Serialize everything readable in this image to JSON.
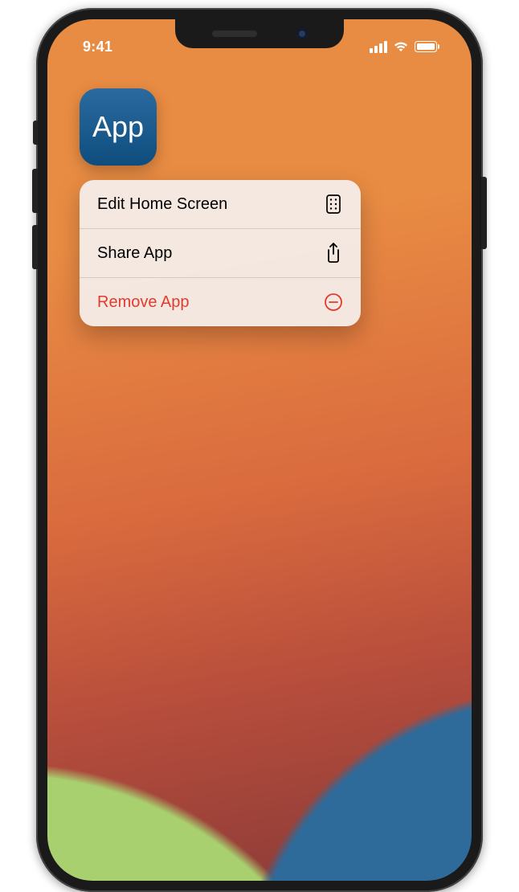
{
  "status": {
    "time": "9:41"
  },
  "app": {
    "icon_label": "App"
  },
  "context_menu": {
    "items": [
      {
        "label": "Edit Home Screen",
        "icon": "apps",
        "destructive": false
      },
      {
        "label": "Share App",
        "icon": "share",
        "destructive": false
      },
      {
        "label": "Remove App",
        "icon": "minus-circle",
        "destructive": true
      }
    ]
  },
  "colors": {
    "destructive": "#e23b2e"
  }
}
